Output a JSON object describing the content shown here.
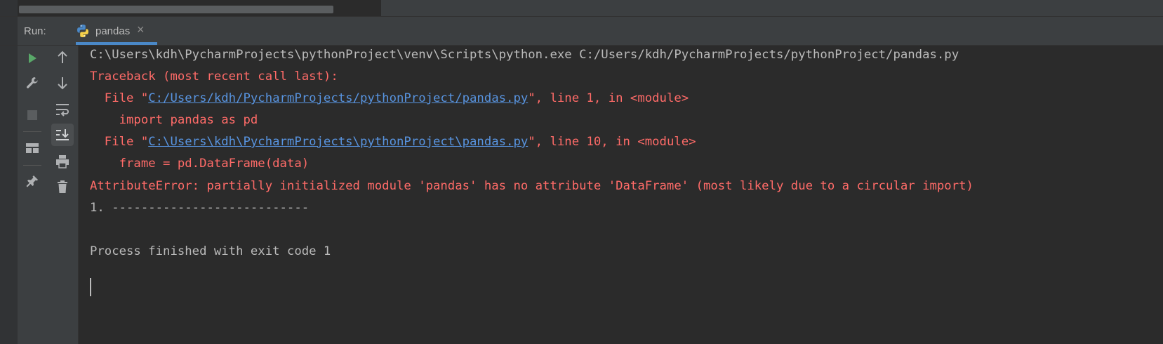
{
  "run_header": {
    "label": "Run:",
    "tab_title": "pandas",
    "close_glyph": "×"
  },
  "toolbar_left": [
    {
      "name": "run-icon"
    },
    {
      "name": "wrench-icon"
    },
    {
      "name": "stop-icon"
    },
    {
      "name": "layout-icon"
    },
    {
      "name": "pin-icon"
    }
  ],
  "toolbar_right": [
    {
      "name": "arrow-up-icon"
    },
    {
      "name": "arrow-down-icon"
    },
    {
      "name": "soft-wrap-icon"
    },
    {
      "name": "scroll-to-end-icon"
    },
    {
      "name": "print-icon"
    },
    {
      "name": "trash-icon"
    }
  ],
  "console": {
    "command_line": "C:\\Users\\kdh\\PycharmProjects\\pythonProject\\venv\\Scripts\\python.exe C:/Users/kdh/PycharmProjects/pythonProject/pandas.py",
    "traceback_header": "Traceback (most recent call last):",
    "frame1": {
      "prefix": "  File \"",
      "path": "C:/Users/kdh/PycharmProjects/pythonProject/pandas.py",
      "suffix": "\", line 1, in <module>"
    },
    "frame1_code": "    import pandas as pd",
    "frame2": {
      "prefix": "  File \"",
      "path": "C:\\Users\\kdh\\PycharmProjects\\pythonProject\\pandas.py",
      "suffix": "\", line 10, in <module>"
    },
    "frame2_code": "    frame = pd.DataFrame(data)",
    "error_line": "AttributeError: partially initialized module 'pandas' has no attribute 'DataFrame' (most likely due to a circular import)",
    "dashes_line": "1. ---------------------------",
    "exit_line": "Process finished with exit code 1"
  },
  "colors": {
    "background": "#2b2b2b",
    "toolbar": "#3c3f41",
    "normal_text": "#bbbbbb",
    "error_text": "#ff6b68",
    "link_text": "#5894e0",
    "run_green": "#59a869",
    "tab_underline": "#4a88c7"
  }
}
